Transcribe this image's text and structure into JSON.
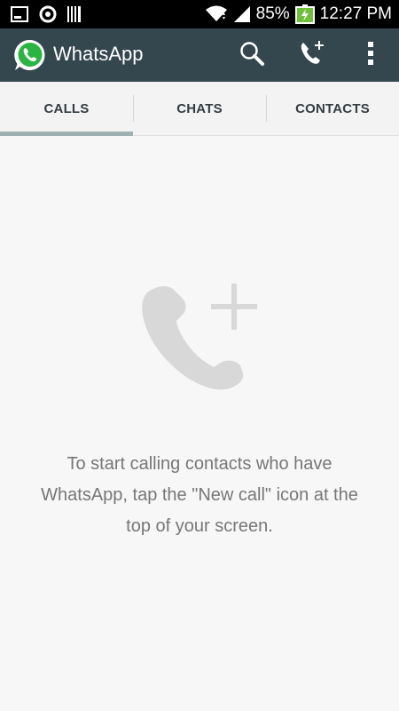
{
  "status_bar": {
    "battery": "85%",
    "time": "12:27 PM",
    "icons": [
      "screen-icon",
      "sync-icon",
      "barcode-icon",
      "wifi-icon",
      "signal-icon",
      "battery-charging-icon"
    ]
  },
  "app_bar": {
    "title": "WhatsApp",
    "actions": [
      "search-icon",
      "new-call-icon",
      "overflow-menu-icon"
    ],
    "background_color": "#34474f"
  },
  "tabs": [
    {
      "label": "CALLS",
      "selected": true
    },
    {
      "label": "CHATS",
      "selected": false
    },
    {
      "label": "CONTACTS",
      "selected": false
    }
  ],
  "empty_state": {
    "icon": "new-call-icon",
    "message": "To start calling contacts who have WhatsApp, tap the \"New call\" icon at the top of your screen."
  },
  "colors": {
    "accent": "#9fb1b0",
    "logo_green": "#2ab540"
  }
}
